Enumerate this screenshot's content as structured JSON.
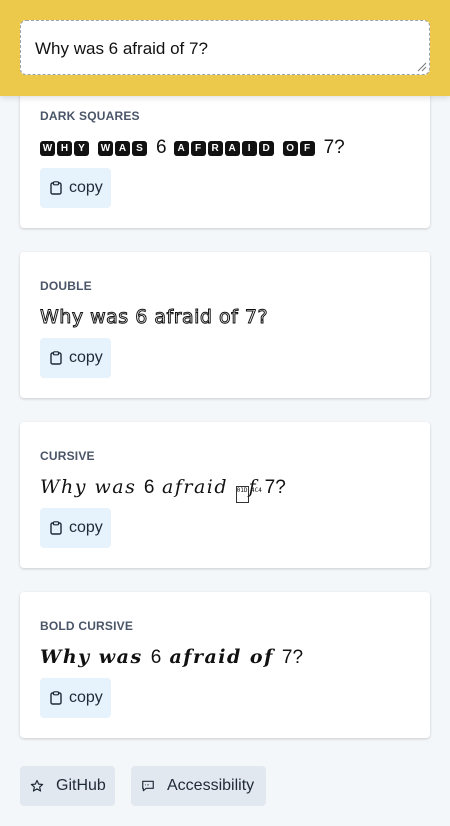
{
  "input": {
    "value": "Why was 6 afraid of 7?"
  },
  "cards": [
    {
      "label": "DARK SQUARES",
      "words": [
        [
          "W",
          "H",
          "Y"
        ],
        [
          "W",
          "A",
          "S"
        ],
        "6",
        [
          "A",
          "F",
          "R",
          "A",
          "I",
          "D"
        ],
        [
          "O",
          "F"
        ],
        "7?"
      ],
      "copy": "copy"
    },
    {
      "label": "DOUBLE",
      "text": "Why was 6 afraid of 7?",
      "copy": "copy"
    },
    {
      "label": "CURSIVE",
      "text_a": "Why was ",
      "text_b": "6",
      "text_c": " afraid ",
      "box_glyph": "01D 4C4",
      "text_d": "f ",
      "text_e": "7?",
      "copy": "copy"
    },
    {
      "label": "BOLD CURSIVE",
      "text_a": "Why was ",
      "text_b": "6",
      "text_c": " afraid of ",
      "text_d": "7?",
      "copy": "copy"
    }
  ],
  "footer": {
    "github": "GitHub",
    "accessibility": "Accessibility"
  }
}
